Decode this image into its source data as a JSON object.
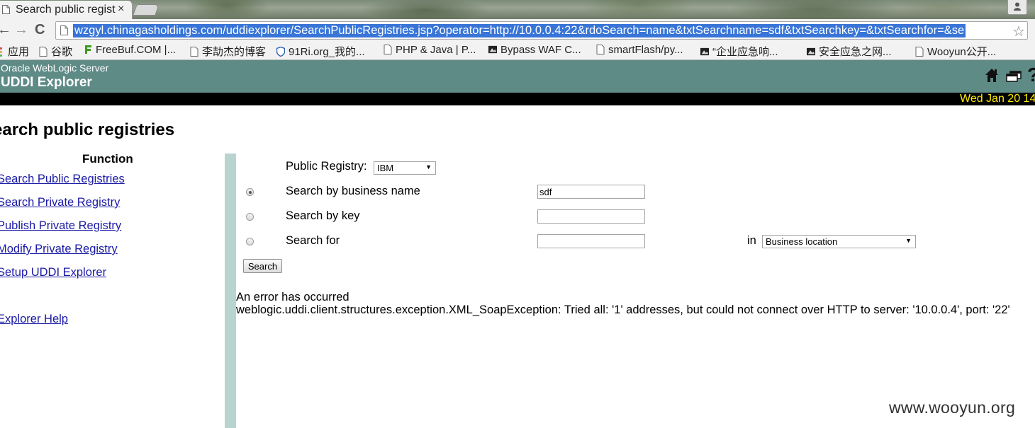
{
  "browser": {
    "tab_title": "Search public regist",
    "tab_close": "×",
    "url": "wzgyl.chinagasholdings.com/uddiexplorer/SearchPublicRegistries.jsp?operator=http://10.0.0.4:22&rdoSearch=name&txtSearchname=sdf&txtSearchkey=&txtSearchfor=&se",
    "back": "←",
    "forward": "→",
    "reload": "C",
    "star": "☆",
    "bookmarks": [
      {
        "label": "应用",
        "icon": "apps-grid-icon"
      },
      {
        "label": "谷歌",
        "icon": "page-icon"
      },
      {
        "label": "FreeBuf.COM |...",
        "icon": "freebuf-icon"
      },
      {
        "label": "李劼杰的博客",
        "icon": "page-icon"
      },
      {
        "label": "91Ri.org_我的...",
        "icon": "shield-icon"
      },
      {
        "label": "PHP & Java | P...",
        "icon": "page-icon"
      },
      {
        "label": "Bypass WAF C...",
        "icon": "image-icon"
      },
      {
        "label": "smartFlash/py...",
        "icon": "page-icon"
      },
      {
        "label": "“企业应急响...",
        "icon": "image-icon"
      },
      {
        "label": "安全应急之网...",
        "icon": "image-icon"
      },
      {
        "label": "Wooyun公开...",
        "icon": "page-icon"
      }
    ]
  },
  "header": {
    "product": "Oracle WebLogic Server",
    "app": "UDDI Explorer",
    "help_glyph": "?",
    "date": "Wed Jan 20 14"
  },
  "page": {
    "title": "earch public registries"
  },
  "sidebar": {
    "heading": "Function",
    "links": [
      "Search Public Registries",
      "Search Private Registry",
      "Publish Private Registry",
      "Modify Private Registry",
      "Setup UDDI Explorer",
      "Explorer Help"
    ]
  },
  "form": {
    "public_registry_label": "Public Registry:",
    "public_registry_value": "IBM",
    "options": [
      {
        "label": "Search by business name",
        "checked": true,
        "value": "sdf"
      },
      {
        "label": "Search by key",
        "checked": false,
        "value": ""
      },
      {
        "label": "Search for",
        "checked": false,
        "value": ""
      }
    ],
    "in_label": "in",
    "location_value": "Business location",
    "search_button": "Search"
  },
  "error": {
    "heading": "An error has occurred",
    "message": "weblogic.uddi.client.structures.exception.XML_SoapException: Tried all: '1' addresses, but could not connect over HTTP to server: '10.0.0.4', port: '22'"
  },
  "watermark": "www.wooyun.org",
  "colors": {
    "header_bg": "#5f8b87",
    "date_text": "#ffec00",
    "divider": "#b9d3d0",
    "link": "#1a1aa6",
    "url_highlight": "#3875d7"
  }
}
